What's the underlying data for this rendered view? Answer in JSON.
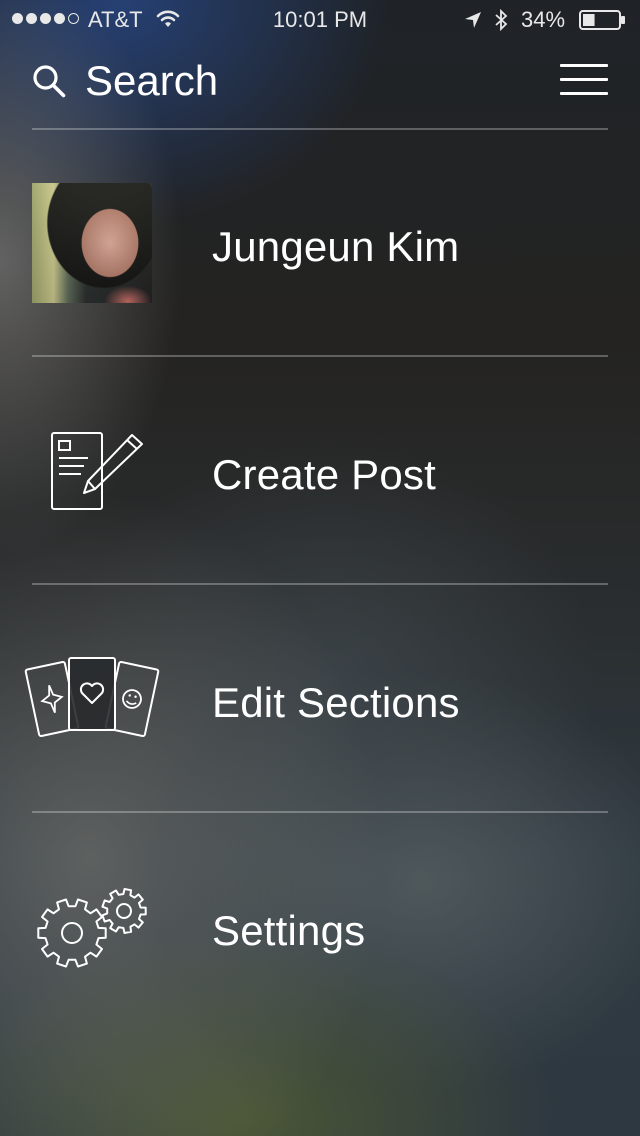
{
  "status_bar": {
    "carrier": "AT&T",
    "time": "10:01 PM",
    "battery_percent": "34%",
    "battery_level": 0.34,
    "signal_bars_filled": 4,
    "signal_bars_total": 5,
    "icons": [
      "wifi-icon",
      "location-arrow-icon",
      "bluetooth-icon",
      "battery-icon"
    ]
  },
  "header": {
    "search_label": "Search",
    "icons": [
      "search-icon",
      "hamburger-menu-icon"
    ]
  },
  "menu": {
    "items": [
      {
        "label": "Jungeun Kim",
        "icon": "profile-avatar"
      },
      {
        "label": "Create Post",
        "icon": "create-post-icon"
      },
      {
        "label": "Edit Sections",
        "icon": "sections-cards-icon"
      },
      {
        "label": "Settings",
        "icon": "gears-icon"
      }
    ]
  },
  "colors": {
    "text": "#ffffff",
    "divider": "rgba(255,255,255,0.28)",
    "top_tint": "#26427a"
  }
}
